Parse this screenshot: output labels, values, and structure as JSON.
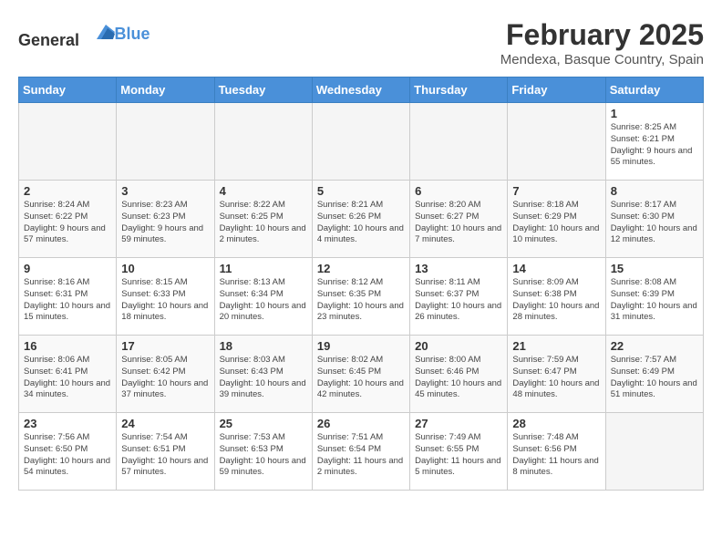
{
  "header": {
    "logo_general": "General",
    "logo_blue": "Blue",
    "month": "February 2025",
    "location": "Mendexa, Basque Country, Spain"
  },
  "days_of_week": [
    "Sunday",
    "Monday",
    "Tuesday",
    "Wednesday",
    "Thursday",
    "Friday",
    "Saturday"
  ],
  "weeks": [
    [
      {
        "day": "",
        "info": ""
      },
      {
        "day": "",
        "info": ""
      },
      {
        "day": "",
        "info": ""
      },
      {
        "day": "",
        "info": ""
      },
      {
        "day": "",
        "info": ""
      },
      {
        "day": "",
        "info": ""
      },
      {
        "day": "1",
        "info": "Sunrise: 8:25 AM\nSunset: 6:21 PM\nDaylight: 9 hours and 55 minutes."
      }
    ],
    [
      {
        "day": "2",
        "info": "Sunrise: 8:24 AM\nSunset: 6:22 PM\nDaylight: 9 hours and 57 minutes."
      },
      {
        "day": "3",
        "info": "Sunrise: 8:23 AM\nSunset: 6:23 PM\nDaylight: 9 hours and 59 minutes."
      },
      {
        "day": "4",
        "info": "Sunrise: 8:22 AM\nSunset: 6:25 PM\nDaylight: 10 hours and 2 minutes."
      },
      {
        "day": "5",
        "info": "Sunrise: 8:21 AM\nSunset: 6:26 PM\nDaylight: 10 hours and 4 minutes."
      },
      {
        "day": "6",
        "info": "Sunrise: 8:20 AM\nSunset: 6:27 PM\nDaylight: 10 hours and 7 minutes."
      },
      {
        "day": "7",
        "info": "Sunrise: 8:18 AM\nSunset: 6:29 PM\nDaylight: 10 hours and 10 minutes."
      },
      {
        "day": "8",
        "info": "Sunrise: 8:17 AM\nSunset: 6:30 PM\nDaylight: 10 hours and 12 minutes."
      }
    ],
    [
      {
        "day": "9",
        "info": "Sunrise: 8:16 AM\nSunset: 6:31 PM\nDaylight: 10 hours and 15 minutes."
      },
      {
        "day": "10",
        "info": "Sunrise: 8:15 AM\nSunset: 6:33 PM\nDaylight: 10 hours and 18 minutes."
      },
      {
        "day": "11",
        "info": "Sunrise: 8:13 AM\nSunset: 6:34 PM\nDaylight: 10 hours and 20 minutes."
      },
      {
        "day": "12",
        "info": "Sunrise: 8:12 AM\nSunset: 6:35 PM\nDaylight: 10 hours and 23 minutes."
      },
      {
        "day": "13",
        "info": "Sunrise: 8:11 AM\nSunset: 6:37 PM\nDaylight: 10 hours and 26 minutes."
      },
      {
        "day": "14",
        "info": "Sunrise: 8:09 AM\nSunset: 6:38 PM\nDaylight: 10 hours and 28 minutes."
      },
      {
        "day": "15",
        "info": "Sunrise: 8:08 AM\nSunset: 6:39 PM\nDaylight: 10 hours and 31 minutes."
      }
    ],
    [
      {
        "day": "16",
        "info": "Sunrise: 8:06 AM\nSunset: 6:41 PM\nDaylight: 10 hours and 34 minutes."
      },
      {
        "day": "17",
        "info": "Sunrise: 8:05 AM\nSunset: 6:42 PM\nDaylight: 10 hours and 37 minutes."
      },
      {
        "day": "18",
        "info": "Sunrise: 8:03 AM\nSunset: 6:43 PM\nDaylight: 10 hours and 39 minutes."
      },
      {
        "day": "19",
        "info": "Sunrise: 8:02 AM\nSunset: 6:45 PM\nDaylight: 10 hours and 42 minutes."
      },
      {
        "day": "20",
        "info": "Sunrise: 8:00 AM\nSunset: 6:46 PM\nDaylight: 10 hours and 45 minutes."
      },
      {
        "day": "21",
        "info": "Sunrise: 7:59 AM\nSunset: 6:47 PM\nDaylight: 10 hours and 48 minutes."
      },
      {
        "day": "22",
        "info": "Sunrise: 7:57 AM\nSunset: 6:49 PM\nDaylight: 10 hours and 51 minutes."
      }
    ],
    [
      {
        "day": "23",
        "info": "Sunrise: 7:56 AM\nSunset: 6:50 PM\nDaylight: 10 hours and 54 minutes."
      },
      {
        "day": "24",
        "info": "Sunrise: 7:54 AM\nSunset: 6:51 PM\nDaylight: 10 hours and 57 minutes."
      },
      {
        "day": "25",
        "info": "Sunrise: 7:53 AM\nSunset: 6:53 PM\nDaylight: 10 hours and 59 minutes."
      },
      {
        "day": "26",
        "info": "Sunrise: 7:51 AM\nSunset: 6:54 PM\nDaylight: 11 hours and 2 minutes."
      },
      {
        "day": "27",
        "info": "Sunrise: 7:49 AM\nSunset: 6:55 PM\nDaylight: 11 hours and 5 minutes."
      },
      {
        "day": "28",
        "info": "Sunrise: 7:48 AM\nSunset: 6:56 PM\nDaylight: 11 hours and 8 minutes."
      },
      {
        "day": "",
        "info": ""
      }
    ]
  ]
}
